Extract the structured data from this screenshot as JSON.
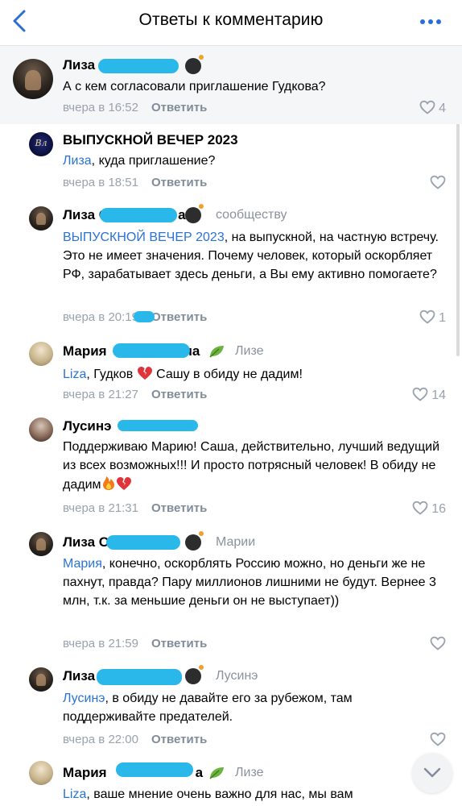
{
  "header": {
    "title": "Ответы к комментарию"
  },
  "colors": {
    "accent": "#2a73d6",
    "meta": "#99a2ad",
    "scribble": "#2ab7ea"
  },
  "comments": [
    {
      "author": "Лиза С",
      "text": "А с кем согласовали приглашение Гудкова?",
      "time": "вчера в 16:52",
      "reply_label": "Ответить",
      "likes": "4"
    },
    {
      "author": "ВЫПУСКНОЙ ВЕЧЕР 2023",
      "text_mention": "Лиза",
      "text": ", куда приглашение?",
      "time": "вчера в 18:51",
      "reply_label": "Ответить",
      "likes": ""
    },
    {
      "author": "Лиза С",
      "author_suffix": "а",
      "reply_to": "сообществу",
      "text_mention": "ВЫПУСКНОЙ ВЕЧЕР 2023",
      "text": ", на выпускной, на частную встречу. Это не имеет значения. Почему человек, который оскорбляет РФ, зарабатывает здесь деньги, а Вы ему активно помогаете?",
      "time": "вчера в 20:19",
      "reply_label": "Ответить",
      "likes": "1"
    },
    {
      "author": "Мария",
      "author_suffix": "на",
      "reply_to": "Лизе",
      "text_mention": "Liza",
      "text_a": ", Гудков",
      "text_b": " Сашу в обиду не дадим!",
      "time": "вчера в 21:27",
      "reply_label": "Ответить",
      "likes": "14"
    },
    {
      "author": "Лусинэ",
      "text": "Поддерживаю Марию! Саша, действительно, лучший ведущий из всех возможных!!! И просто потрясный человек! В обиду не дадим",
      "time": "вчера в 21:31",
      "reply_label": "Ответить",
      "likes": "16"
    },
    {
      "author": "Лиза С",
      "reply_to": "Марии",
      "text_mention": "Мария",
      "text": ", конечно, оскорблять Россию можно, но деньги же не пахнут, правда? Пару миллионов лишними не будут. Вернее 3 млн, т.к. за меньшие деньги он не выступает))",
      "time": "вчера в 21:59",
      "reply_label": "Ответить",
      "likes": ""
    },
    {
      "author": "Лиза",
      "reply_to": "Лусинэ",
      "text_mention": "Лусинэ",
      "text": ", в обиду не давайте его за рубежом, там поддерживайте предателей.",
      "time": "вчера в 22:00",
      "reply_label": "Ответить",
      "likes": ""
    },
    {
      "author": "Мария",
      "author_suffix": "а",
      "reply_to": "Лизе",
      "text_mention": "Liza",
      "text": ", ваше мнение очень важно для нас, мы вам",
      "time": "",
      "reply_label": "",
      "likes": ""
    }
  ]
}
